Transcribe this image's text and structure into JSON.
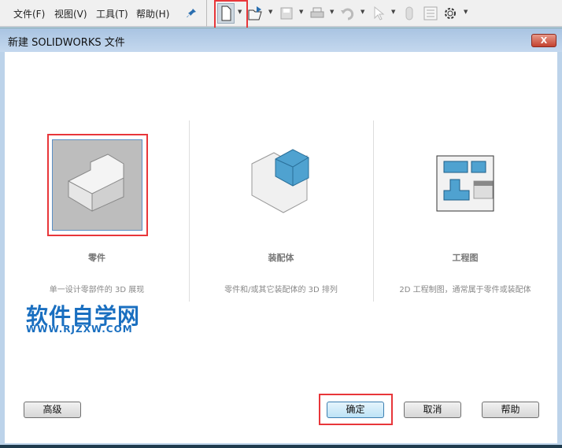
{
  "menu": {
    "file": "文件(F)",
    "view": "视图(V)",
    "tools": "工具(T)",
    "help": "帮助(H)"
  },
  "toolbar_icons": [
    "new-document-icon",
    "open-icon",
    "save-icon",
    "print-icon",
    "undo-icon",
    "select-icon",
    "rebuild-icon",
    "options-list-icon",
    "gear-icon"
  ],
  "dialog": {
    "title": "新建 SOLIDWORKS 文件",
    "close": "X"
  },
  "templates": [
    {
      "label": "零件",
      "desc": "单一设计零部件的 3D 展现"
    },
    {
      "label": "装配体",
      "desc": "零件和/或其它装配体的 3D 排列"
    },
    {
      "label": "工程图",
      "desc": "2D 工程制图，通常属于零件或装配体"
    }
  ],
  "watermark": {
    "title": "软件自学网",
    "url": "WWW.RJZXW.COM"
  },
  "buttons": {
    "advanced": "高级",
    "ok": "确定",
    "cancel": "取消",
    "help": "帮助"
  },
  "colors": {
    "highlight": "#e8363a",
    "accent": "#1a6fc0"
  }
}
